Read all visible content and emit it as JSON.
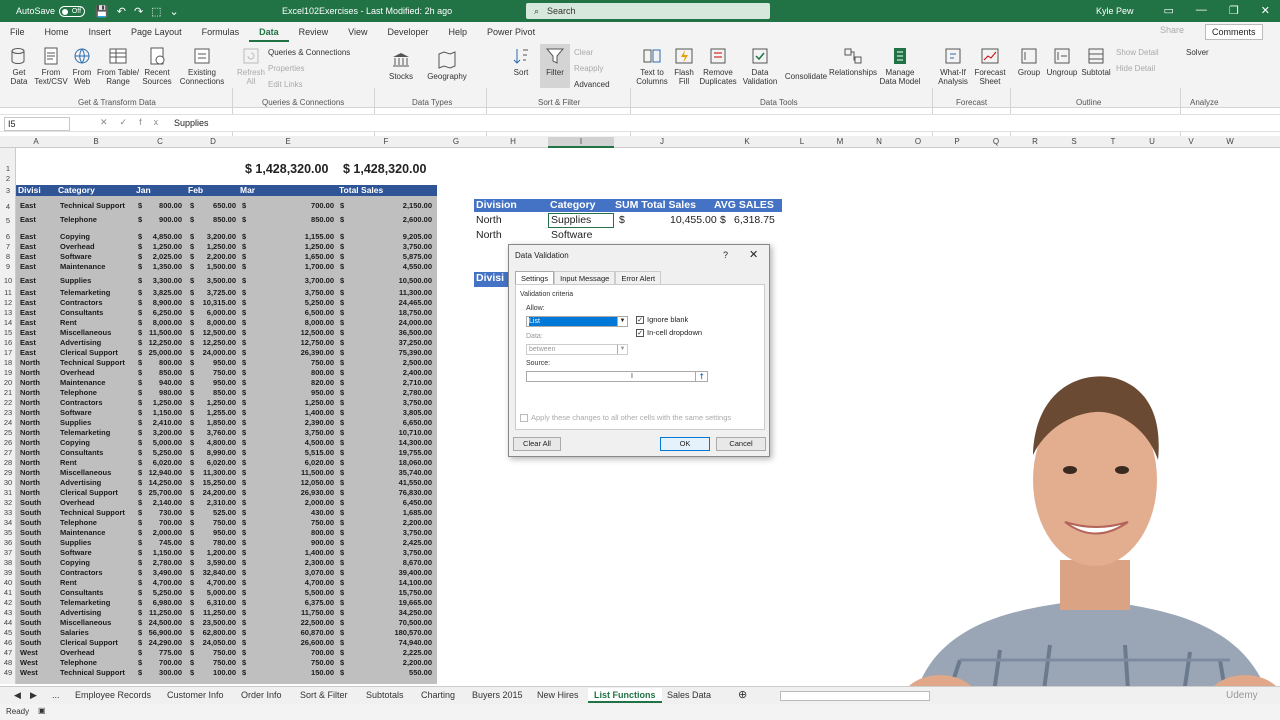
{
  "titlebar": {
    "autosave": "AutoSave",
    "toggle": "Off",
    "doc_title": "Excel102Exercises  -  Last Modified: 2h ago",
    "search_placeholder": "Search",
    "user": "Kyle Pew",
    "color": "#217346"
  },
  "menu": {
    "tabs": [
      "File",
      "Home",
      "Insert",
      "Page Layout",
      "Formulas",
      "Data",
      "Review",
      "View",
      "Developer",
      "Help",
      "Power Pivot"
    ],
    "share": "Share",
    "comments": "Comments"
  },
  "ribbon": {
    "get_data": "Get Data",
    "from_text": "From Text/CSV",
    "from_web": "From Web",
    "from_table": "From Table/ Range",
    "recent": "Recent Sources",
    "existing": "Existing Connections",
    "refresh": "Refresh All",
    "queries": "Queries & Connections",
    "properties": "Properties",
    "edit_links": "Edit Links",
    "stocks": "Stocks",
    "geography": "Geography",
    "sort": "Sort",
    "filter": "Filter",
    "clear": "Clear",
    "reapply": "Reapply",
    "advanced": "Advanced",
    "text_to_columns": "Text to Columns",
    "flash_fill": "Flash Fill",
    "remove_dup": "Remove Duplicates",
    "validation": "Data Validation",
    "consolidate": "Consolidate",
    "relationships": "Relationships",
    "manage_model": "Manage Data Model",
    "what_if": "What-If Analysis",
    "forecast_sheet": "Forecast Sheet",
    "group": "Group",
    "ungroup": "Ungroup",
    "subtotal": "Subtotal",
    "show_detail": "Show Detail",
    "hide_detail": "Hide Detail",
    "solver": "Solver",
    "groups": [
      "Get & Transform Data",
      "Queries & Connections",
      "Data Types",
      "Sort & Filter",
      "Data Tools",
      "Forecast",
      "Outline",
      "Analyze"
    ]
  },
  "formula_bar": {
    "name_box": "I5",
    "value": "Supplies"
  },
  "columns": [
    "A",
    "B",
    "C",
    "D",
    "E",
    "F",
    "G",
    "H",
    "I",
    "J",
    "K",
    "L",
    "M",
    "N",
    "O",
    "P",
    "Q",
    "R",
    "S",
    "T",
    "U",
    "V",
    "W"
  ],
  "totals": {
    "e1": "$ 1,428,320.00",
    "f1": "$ 1,428,320.00"
  },
  "table": {
    "headers": [
      "Divisi",
      "Category",
      "Jan",
      "Feb",
      "Mar",
      "Total Sales"
    ],
    "rows": [
      [
        "4",
        "East",
        "Technical Support",
        "800.00",
        "650.00",
        "700.00",
        "2,150.00"
      ],
      [
        "5",
        "East",
        "Telephone",
        "900.00",
        "850.00",
        "850.00",
        "2,600.00"
      ],
      [
        "6",
        "East",
        "Copying",
        "4,850.00",
        "3,200.00",
        "1,155.00",
        "9,205.00"
      ],
      [
        "7",
        "East",
        "Overhead",
        "1,250.00",
        "1,250.00",
        "1,250.00",
        "3,750.00"
      ],
      [
        "8",
        "East",
        "Software",
        "2,025.00",
        "2,200.00",
        "1,650.00",
        "5,875.00"
      ],
      [
        "9",
        "East",
        "Maintenance",
        "1,350.00",
        "1,500.00",
        "1,700.00",
        "4,550.00"
      ],
      [
        "10",
        "East",
        "Supplies",
        "3,300.00",
        "3,500.00",
        "3,700.00",
        "10,500.00"
      ],
      [
        "11",
        "East",
        "Telemarketing",
        "3,825.00",
        "3,725.00",
        "3,750.00",
        "11,300.00"
      ],
      [
        "12",
        "East",
        "Contractors",
        "8,900.00",
        "10,315.00",
        "5,250.00",
        "24,465.00"
      ],
      [
        "13",
        "East",
        "Consultants",
        "6,250.00",
        "6,000.00",
        "6,500.00",
        "18,750.00"
      ],
      [
        "14",
        "East",
        "Rent",
        "8,000.00",
        "8,000.00",
        "8,000.00",
        "24,000.00"
      ],
      [
        "15",
        "East",
        "Miscellaneous",
        "11,500.00",
        "12,500.00",
        "12,500.00",
        "36,500.00"
      ],
      [
        "16",
        "East",
        "Advertising",
        "12,250.00",
        "12,250.00",
        "12,750.00",
        "37,250.00"
      ],
      [
        "17",
        "East",
        "Clerical Support",
        "25,000.00",
        "24,000.00",
        "26,390.00",
        "75,390.00"
      ],
      [
        "18",
        "North",
        "Technical Support",
        "800.00",
        "950.00",
        "750.00",
        "2,500.00"
      ],
      [
        "19",
        "North",
        "Overhead",
        "850.00",
        "750.00",
        "800.00",
        "2,400.00"
      ],
      [
        "20",
        "North",
        "Maintenance",
        "940.00",
        "950.00",
        "820.00",
        "2,710.00"
      ],
      [
        "21",
        "North",
        "Telephone",
        "980.00",
        "850.00",
        "950.00",
        "2,780.00"
      ],
      [
        "22",
        "North",
        "Contractors",
        "1,250.00",
        "1,250.00",
        "1,250.00",
        "3,750.00"
      ],
      [
        "23",
        "North",
        "Software",
        "1,150.00",
        "1,255.00",
        "1,400.00",
        "3,805.00"
      ],
      [
        "24",
        "North",
        "Supplies",
        "2,410.00",
        "1,850.00",
        "2,390.00",
        "6,650.00"
      ],
      [
        "25",
        "North",
        "Telemarketing",
        "3,200.00",
        "3,760.00",
        "3,750.00",
        "10,710.00"
      ],
      [
        "26",
        "North",
        "Copying",
        "5,000.00",
        "4,800.00",
        "4,500.00",
        "14,300.00"
      ],
      [
        "27",
        "North",
        "Consultants",
        "5,250.00",
        "8,990.00",
        "5,515.00",
        "19,755.00"
      ],
      [
        "28",
        "North",
        "Rent",
        "6,020.00",
        "6,020.00",
        "6,020.00",
        "18,060.00"
      ],
      [
        "29",
        "North",
        "Miscellaneous",
        "12,940.00",
        "11,300.00",
        "11,500.00",
        "35,740.00"
      ],
      [
        "30",
        "North",
        "Advertising",
        "14,250.00",
        "15,250.00",
        "12,050.00",
        "41,550.00"
      ],
      [
        "31",
        "North",
        "Clerical Support",
        "25,700.00",
        "24,200.00",
        "26,930.00",
        "76,830.00"
      ],
      [
        "32",
        "South",
        "Overhead",
        "2,140.00",
        "2,310.00",
        "2,000.00",
        "6,450.00"
      ],
      [
        "33",
        "South",
        "Technical Support",
        "730.00",
        "525.00",
        "430.00",
        "1,685.00"
      ],
      [
        "34",
        "South",
        "Telephone",
        "700.00",
        "750.00",
        "750.00",
        "2,200.00"
      ],
      [
        "35",
        "South",
        "Maintenance",
        "2,000.00",
        "950.00",
        "800.00",
        "3,750.00"
      ],
      [
        "36",
        "South",
        "Supplies",
        "745.00",
        "780.00",
        "900.00",
        "2,425.00"
      ],
      [
        "37",
        "South",
        "Software",
        "1,150.00",
        "1,200.00",
        "1,400.00",
        "3,750.00"
      ],
      [
        "38",
        "South",
        "Copying",
        "2,780.00",
        "3,590.00",
        "2,300.00",
        "8,670.00"
      ],
      [
        "39",
        "South",
        "Contractors",
        "3,490.00",
        "32,840.00",
        "3,070.00",
        "39,400.00"
      ],
      [
        "40",
        "South",
        "Rent",
        "4,700.00",
        "4,700.00",
        "4,700.00",
        "14,100.00"
      ],
      [
        "41",
        "South",
        "Consultants",
        "5,250.00",
        "5,000.00",
        "5,500.00",
        "15,750.00"
      ],
      [
        "42",
        "South",
        "Telemarketing",
        "6,980.00",
        "6,310.00",
        "6,375.00",
        "19,665.00"
      ],
      [
        "43",
        "South",
        "Advertising",
        "11,250.00",
        "11,250.00",
        "11,750.00",
        "34,250.00"
      ],
      [
        "44",
        "South",
        "Miscellaneous",
        "24,500.00",
        "23,500.00",
        "22,500.00",
        "70,500.00"
      ],
      [
        "45",
        "South",
        "Salaries",
        "56,900.00",
        "62,800.00",
        "60,870.00",
        "180,570.00"
      ],
      [
        "46",
        "South",
        "Clerical Support",
        "24,290.00",
        "24,050.00",
        "26,600.00",
        "74,940.00"
      ],
      [
        "47",
        "West",
        "Overhead",
        "775.00",
        "750.00",
        "700.00",
        "2,225.00"
      ],
      [
        "48",
        "West",
        "Telephone",
        "700.00",
        "750.00",
        "750.00",
        "2,200.00"
      ],
      [
        "49",
        "West",
        "Technical Support",
        "300.00",
        "100.00",
        "150.00",
        "550.00"
      ]
    ]
  },
  "right_table": {
    "headers": [
      "Division",
      "Category",
      "SUM Total Sales",
      "AVG SALES"
    ],
    "row1": {
      "division": "North",
      "category": "Supplies",
      "sum": "10,455.00",
      "avg": "6,318.75"
    },
    "row2": {
      "division": "North",
      "category": "Software"
    },
    "division_label": "Divisi"
  },
  "dialog": {
    "title": "Data Validation",
    "help": "?",
    "tabs": [
      "Settings",
      "Input Message",
      "Error Alert"
    ],
    "criteria": "Validation criteria",
    "allow_label": "Allow:",
    "allow_value": "List",
    "data_label": "Data:",
    "data_value": "between",
    "ignore_blank": "Ignore blank",
    "in_cell": "In-cell dropdown",
    "source_label": "Source:",
    "apply_all": "Apply these changes to all other cells with the same settings",
    "clear_all": "Clear All",
    "ok": "OK",
    "cancel": "Cancel"
  },
  "sheet_tabs": [
    "Employee Records",
    "Customer Info",
    "Order Info",
    "Sort & Filter",
    "Subtotals",
    "Charting",
    "Buyers 2015",
    "New Hires",
    "List Functions",
    "Sales Data"
  ],
  "active_sheet": "List Functions",
  "status": {
    "ready": "Ready",
    "watermark": "Udemy"
  }
}
